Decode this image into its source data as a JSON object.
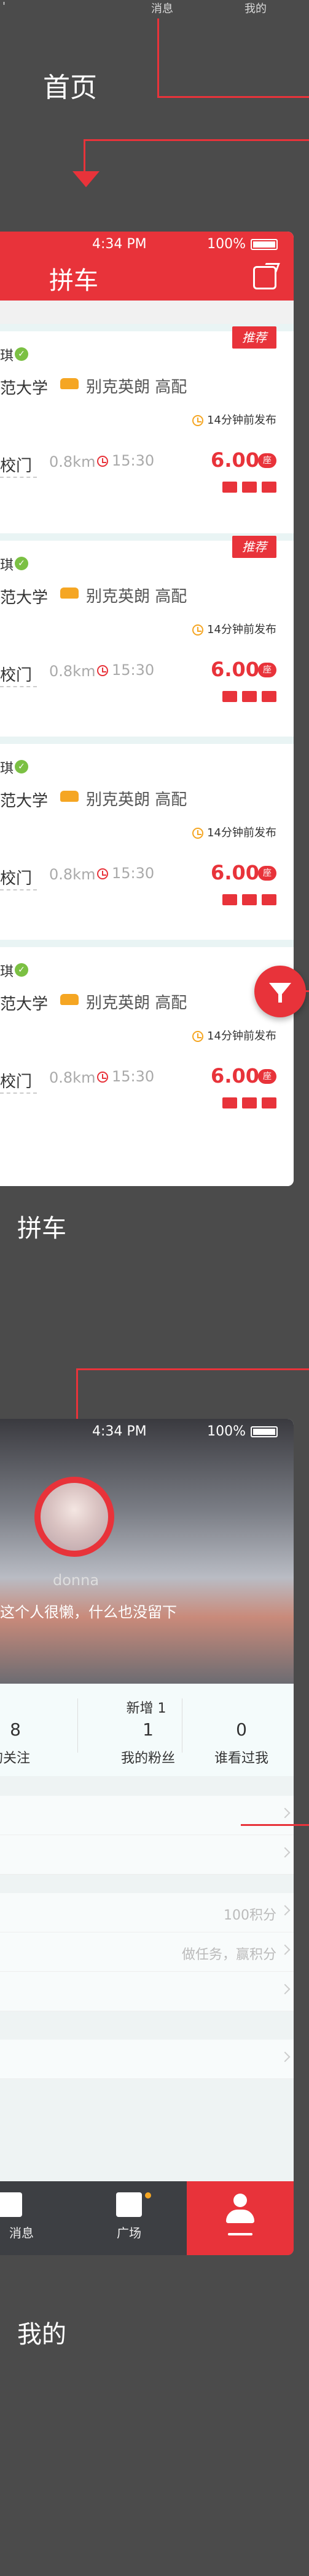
{
  "top_nav": {
    "messages_label": "消息",
    "mine_label": "我的",
    "dot": "'"
  },
  "sections": {
    "home_label": "首页",
    "carpool_label": "拼车",
    "mine_label": "我的"
  },
  "carpool_screen": {
    "status_time": "4:34 PM",
    "battery_text": "100%",
    "title": "拼车",
    "share_icon": "share-icon",
    "filter_icon": "filter-icon",
    "cards": [
      {
        "owner_frag": "琪",
        "recommended_tag": "推荐",
        "school": "范大学",
        "car": "别克英朗 高配",
        "posted": "14分钟前发布",
        "from": "校门",
        "distance": "0.8km",
        "time": "15:30",
        "price": "6.00",
        "seat_badge": "座"
      },
      {
        "owner_frag": "琪",
        "recommended_tag": "推荐",
        "school": "范大学",
        "car": "别克英朗 高配",
        "posted": "14分钟前发布",
        "from": "校门",
        "distance": "0.8km",
        "time": "15:30",
        "price": "6.00",
        "seat_badge": "座"
      },
      {
        "owner_frag": "琪",
        "recommended_tag": "",
        "school": "范大学",
        "car": "别克英朗 高配",
        "posted": "14分钟前发布",
        "from": "校门",
        "distance": "0.8km",
        "time": "15:30",
        "price": "6.00",
        "seat_badge": "座"
      },
      {
        "owner_frag": "琪",
        "recommended_tag": "",
        "school": "范大学",
        "car": "别克英朗 高配",
        "posted": "14分钟前发布",
        "from": "校门",
        "distance": "0.8km",
        "time": "15:30",
        "price": "6.00",
        "seat_badge": "座"
      }
    ]
  },
  "profile_screen": {
    "status_time": "4:34 PM",
    "battery_text": "100%",
    "nickname": "donna",
    "bio": "这个人很懒，什么也没留下",
    "new_label": "新增 1",
    "stats": [
      {
        "num": "8",
        "label": "我的关注"
      },
      {
        "num": "1",
        "label": "我的粉丝"
      },
      {
        "num": "0",
        "label": "谁看过我"
      }
    ],
    "points": "100积分",
    "task_hint": "做任务，赢积分",
    "tabs": {
      "messages": "消息",
      "square": "广场"
    }
  },
  "colors": {
    "accent": "#e8333a",
    "background": "#4b4b4b"
  }
}
